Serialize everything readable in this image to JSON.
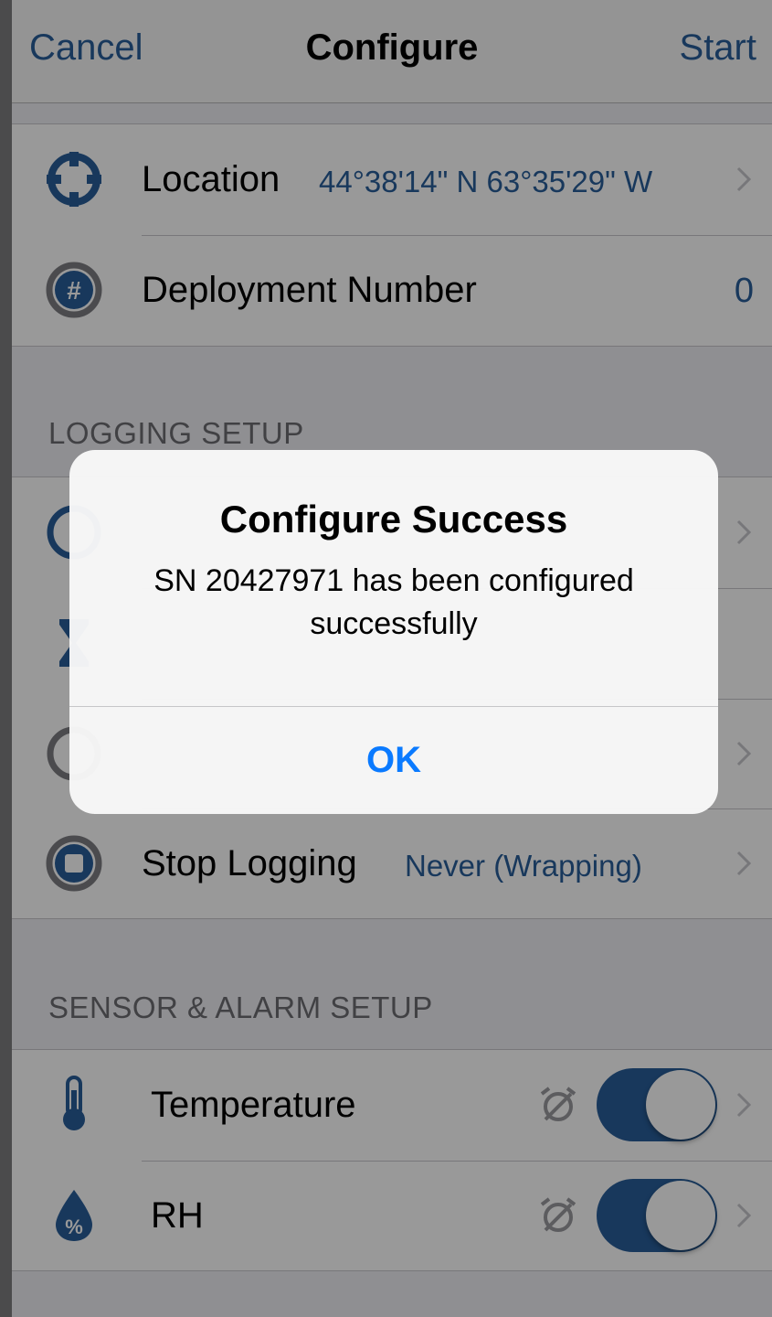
{
  "nav": {
    "cancel": "Cancel",
    "title": "Configure",
    "start": "Start"
  },
  "general": {
    "rows": [
      {
        "label": "Location",
        "value": "44°38'14\" N 63°35'29\" W",
        "icon": "location-crosshair-icon"
      },
      {
        "label": "Deployment Number",
        "value": "0",
        "icon": "hash-icon"
      }
    ]
  },
  "logging": {
    "header": "LOGGING SETUP",
    "rows": [
      {
        "label": "Stop Logging",
        "value": "Never (Wrapping)",
        "icon": "stop-icon"
      }
    ]
  },
  "sensors": {
    "header": "SENSOR & ALARM SETUP",
    "rows": [
      {
        "label": "Temperature",
        "icon": "thermometer-icon",
        "enabled": true
      },
      {
        "label": "RH",
        "icon": "humidity-drop-icon",
        "enabled": true
      }
    ]
  },
  "alert": {
    "title": "Configure Success",
    "message": "SN 20427971 has been configured successfully",
    "ok": "OK"
  },
  "colors": {
    "accent": "#285e9a",
    "ios_blue": "#0a7aff",
    "icon_gray": "#8e8e93"
  }
}
